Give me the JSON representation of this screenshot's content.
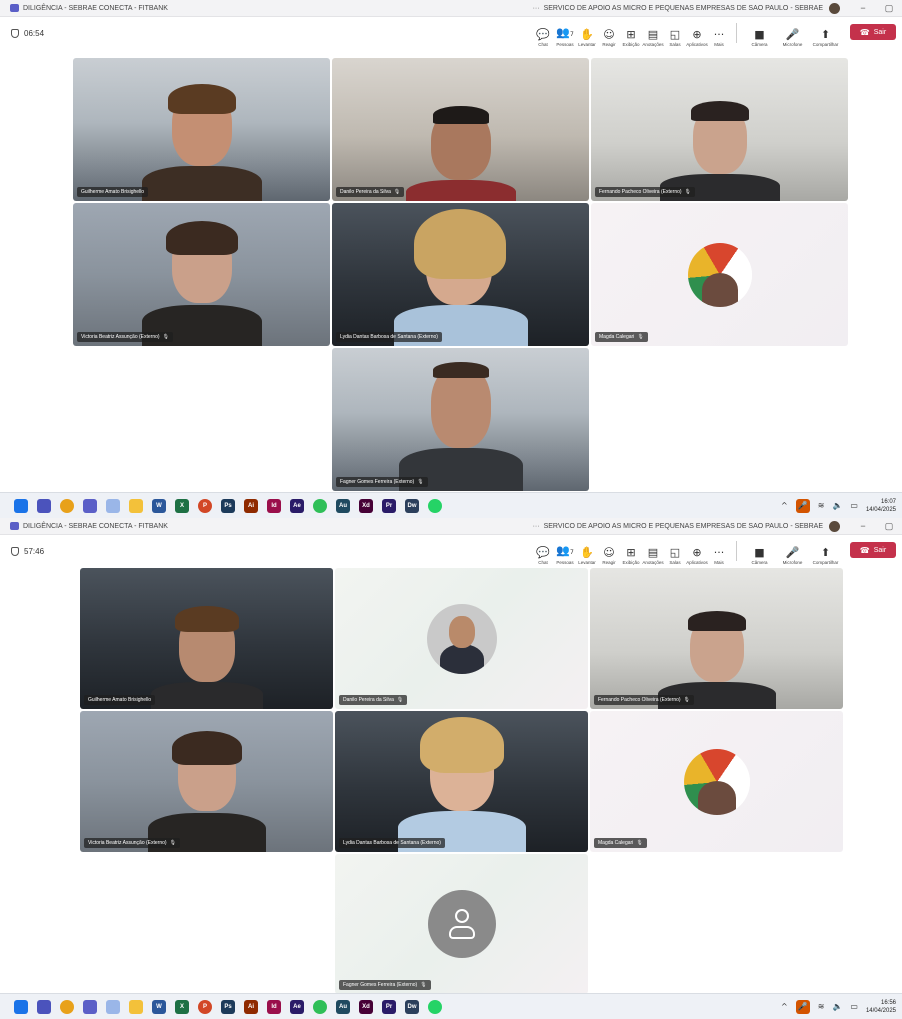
{
  "window": {
    "title": "DILIGÊNCIA - SEBRAE CONECTA - FITBANK",
    "more": "···",
    "org": "SERVICO DE APOIO AS MICRO E PEQUENAS EMPRESAS DE SAO PAULO - SEBRAE",
    "minimize": "−",
    "maximize": "▢"
  },
  "toolbar": {
    "tools": [
      {
        "name": "chat",
        "glyph": "💬",
        "label": "Chat"
      },
      {
        "name": "people",
        "glyph": "👥",
        "label": "Pessoas",
        "count": "7"
      },
      {
        "name": "raise-hand",
        "glyph": "✋",
        "label": "Levantar"
      },
      {
        "name": "react",
        "glyph": "☺",
        "label": "Reagir"
      },
      {
        "name": "view",
        "glyph": "⊞",
        "label": "Exibição"
      },
      {
        "name": "notes",
        "glyph": "▤",
        "label": "Anotações"
      },
      {
        "name": "rooms",
        "glyph": "◱",
        "label": "Salas"
      },
      {
        "name": "apps",
        "glyph": "⊕",
        "label": "Aplicativos"
      },
      {
        "name": "more",
        "glyph": "···",
        "label": "Mais"
      }
    ],
    "media": [
      {
        "name": "camera",
        "glyph": "■",
        "label": "Câmera"
      },
      {
        "name": "mic",
        "glyph": "🎤",
        "label": "Microfone"
      },
      {
        "name": "share",
        "glyph": "⬆",
        "label": "Compartilhar"
      }
    ],
    "leave_label": "Sair",
    "leave_glyph": "☎"
  },
  "shot1": {
    "timer": "06:54",
    "participants": [
      "Guilherme Amato Brisighello",
      "Danilo Pereira da Silva",
      "Fernando Pacheco Oliveira (Externo)",
      "Victoria Beatriz Assunção (Externo)",
      "Lydia Dantas Barbosa de Santana (Externo)",
      "Magda Calegari",
      "Fagner Gomes Ferreira (Externo)"
    ],
    "clock": {
      "time": "16:07",
      "date": "14/04/2025"
    }
  },
  "shot2": {
    "timer": "57:46",
    "participants": [
      "Guilherme Amato Brisighello",
      "Danilo Pereira da Silva",
      "Fernando Pacheco Oliveira (Externo)",
      "Victoria Beatriz Assunção (Externo)",
      "Lydia Dantas Barbosa de Santana (Externo)",
      "Magda Calegari",
      "Fagner Gomes Ferreira (Externo)"
    ],
    "clock": {
      "time": "16:56",
      "date": "14/04/2025"
    }
  },
  "taskbar": {
    "apps": [
      {
        "name": "start",
        "label": "",
        "color": "#1a73e8"
      },
      {
        "name": "teams-classic",
        "label": "",
        "color": "#4b53bc"
      },
      {
        "name": "chrome",
        "label": "",
        "color": "#e8a11a",
        "round": true
      },
      {
        "name": "teams",
        "label": "",
        "color": "#5b5fc7"
      },
      {
        "name": "photos",
        "label": "",
        "color": "#9ab6e8"
      },
      {
        "name": "explorer",
        "label": "",
        "color": "#f3c13a"
      },
      {
        "name": "word",
        "label": "W",
        "color": "#2b579a"
      },
      {
        "name": "excel",
        "label": "X",
        "color": "#1d7044"
      },
      {
        "name": "powerpoint",
        "label": "P",
        "color": "#d24726",
        "round": true
      },
      {
        "name": "photoshop",
        "label": "Ps",
        "color": "#1c3a5a"
      },
      {
        "name": "illustrator",
        "label": "Ai",
        "color": "#8f2a00"
      },
      {
        "name": "indesign",
        "label": "Id",
        "color": "#9a0f4b"
      },
      {
        "name": "after-effects",
        "label": "Ae",
        "color": "#2a1b68"
      },
      {
        "name": "green-app",
        "label": "",
        "color": "#2fbf58",
        "round": true
      },
      {
        "name": "audition",
        "label": "Au",
        "color": "#1f4a60"
      },
      {
        "name": "xd",
        "label": "Xd",
        "color": "#470137"
      },
      {
        "name": "premiere",
        "label": "Pr",
        "color": "#2a1b68"
      },
      {
        "name": "dreamweaver",
        "label": "Dw",
        "color": "#2b3f5c"
      },
      {
        "name": "whatsapp",
        "label": "",
        "color": "#25d366",
        "round": true
      }
    ],
    "tray": {
      "chevron": "^",
      "wifi": "≋",
      "volume": "🔈",
      "battery": "▭",
      "mic": "🎤"
    }
  }
}
